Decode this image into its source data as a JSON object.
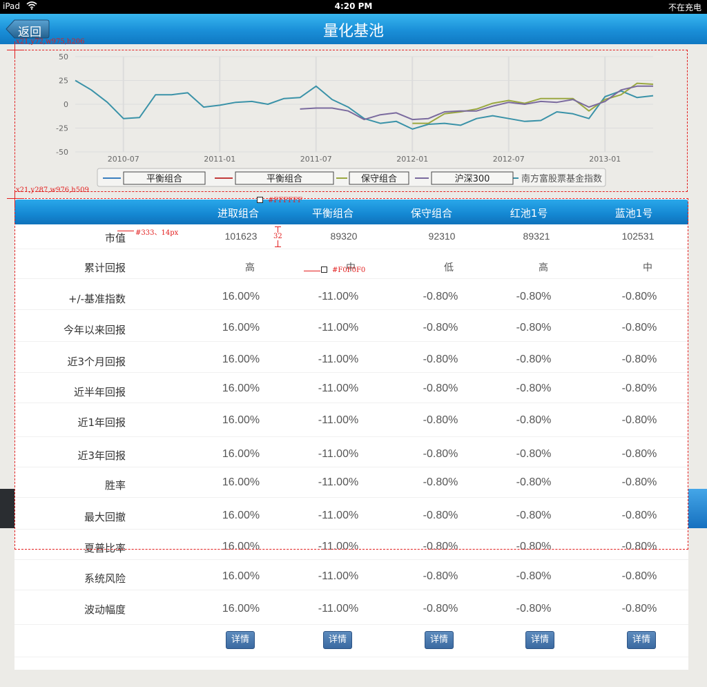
{
  "status_bar": {
    "device": "iPad",
    "time": "4:20 PM",
    "battery": "不在充电"
  },
  "nav": {
    "back_label": "返回",
    "title": "量化基池"
  },
  "chart_data": {
    "type": "line",
    "y_ticks": [
      "50",
      "25",
      "0",
      "-25",
      "-50"
    ],
    "ylim": [
      -50,
      50
    ],
    "x_ticks": [
      "2010-07",
      "2011-01",
      "2011-07",
      "2012-01",
      "2012-07",
      "2013-01"
    ],
    "x_domain": [
      "2010-04",
      "2013-04"
    ],
    "grid": true,
    "legend_position": "bottom",
    "legend_labels": [
      "平衡组合",
      "平衡组合",
      "保守组合",
      "沪深300",
      "南方富股票基金指数"
    ],
    "series": [
      {
        "name": "南方富股票基金指数",
        "color": "#3a92a8",
        "points": [
          [
            "2010-04",
            25
          ],
          [
            "2010-05",
            15
          ],
          [
            "2010-06",
            2
          ],
          [
            "2010-07",
            -15
          ],
          [
            "2010-08",
            -14
          ],
          [
            "2010-09",
            10
          ],
          [
            "2010-10",
            10
          ],
          [
            "2010-11",
            12
          ],
          [
            "2010-12",
            -3
          ],
          [
            "2011-01",
            -1
          ],
          [
            "2011-02",
            2
          ],
          [
            "2011-03",
            3
          ],
          [
            "2011-04",
            0
          ],
          [
            "2011-05",
            6
          ],
          [
            "2011-06",
            7
          ],
          [
            "2011-07",
            19
          ],
          [
            "2011-08",
            5
          ],
          [
            "2011-09",
            -3
          ],
          [
            "2011-10",
            -15
          ],
          [
            "2011-11",
            -20
          ],
          [
            "2011-12",
            -18
          ],
          [
            "2012-01",
            -26
          ],
          [
            "2012-02",
            -21
          ],
          [
            "2012-03",
            -20
          ],
          [
            "2012-04",
            -22
          ],
          [
            "2012-05",
            -15
          ],
          [
            "2012-06",
            -12
          ],
          [
            "2012-07",
            -15
          ],
          [
            "2012-08",
            -18
          ],
          [
            "2012-09",
            -17
          ],
          [
            "2012-10",
            -8
          ],
          [
            "2012-11",
            -10
          ],
          [
            "2012-12",
            -15
          ],
          [
            "2013-01",
            8
          ],
          [
            "2013-02",
            14
          ],
          [
            "2013-03",
            7
          ],
          [
            "2013-04",
            9
          ]
        ]
      },
      {
        "name": "平衡组合",
        "color": "#9aa840",
        "points": [
          [
            "2012-01",
            -20
          ],
          [
            "2012-02",
            -20
          ],
          [
            "2012-03",
            -10
          ],
          [
            "2012-04",
            -8
          ],
          [
            "2012-05",
            -5
          ],
          [
            "2012-06",
            1
          ],
          [
            "2012-07",
            4
          ],
          [
            "2012-08",
            1
          ],
          [
            "2012-09",
            6
          ],
          [
            "2012-10",
            6
          ],
          [
            "2012-11",
            6
          ],
          [
            "2012-12",
            -7
          ],
          [
            "2013-01",
            5
          ],
          [
            "2013-02",
            10
          ],
          [
            "2013-03",
            22
          ],
          [
            "2013-04",
            21
          ]
        ]
      },
      {
        "name": "沪深300",
        "color": "#7a6a9e",
        "points": [
          [
            "2011-06",
            -5
          ],
          [
            "2011-07",
            -4
          ],
          [
            "2011-08",
            -4
          ],
          [
            "2011-09",
            -7
          ],
          [
            "2011-10",
            -16
          ],
          [
            "2011-11",
            -11
          ],
          [
            "2011-12",
            -9
          ],
          [
            "2012-01",
            -16
          ],
          [
            "2012-02",
            -15
          ],
          [
            "2012-03",
            -8
          ],
          [
            "2012-04",
            -7
          ],
          [
            "2012-05",
            -7
          ],
          [
            "2012-06",
            -2
          ],
          [
            "2012-07",
            2
          ],
          [
            "2012-08",
            0
          ],
          [
            "2012-09",
            3
          ],
          [
            "2012-10",
            2
          ],
          [
            "2012-11",
            5
          ],
          [
            "2012-12",
            -3
          ],
          [
            "2013-01",
            3
          ],
          [
            "2013-02",
            15
          ],
          [
            "2013-03",
            19
          ],
          [
            "2013-04",
            19
          ]
        ]
      }
    ]
  },
  "table": {
    "columns": [
      "进取组合",
      "平衡组合",
      "保守组合",
      "红池1号",
      "蓝池1号"
    ],
    "rows": [
      {
        "label": "市值",
        "values": [
          "101623",
          "89320",
          "92310",
          "89321",
          "102531"
        ]
      },
      {
        "label": "累计回报",
        "values": [
          "高",
          "中",
          "低",
          "高",
          "中"
        ]
      },
      {
        "label": "+/-基准指数",
        "values": [
          "16.00%",
          "-11.00%",
          "-0.80%",
          "-0.80%",
          "-0.80%"
        ]
      },
      {
        "label": "今年以来回报",
        "values": [
          "16.00%",
          "-11.00%",
          "-0.80%",
          "-0.80%",
          "-0.80%"
        ]
      },
      {
        "label": "近3个月回报",
        "values": [
          "16.00%",
          "-11.00%",
          "-0.80%",
          "-0.80%",
          "-0.80%"
        ]
      },
      {
        "label": "近半年回报",
        "values": [
          "16.00%",
          "-11.00%",
          "-0.80%",
          "-0.80%",
          "-0.80%"
        ]
      },
      {
        "label": "近1年回报",
        "values": [
          "16.00%",
          "-11.00%",
          "-0.80%",
          "-0.80%",
          "-0.80%"
        ]
      },
      {
        "label": "近3年回报",
        "values": [
          "16.00%",
          "-11.00%",
          "-0.80%",
          "-0.80%",
          "-0.80%"
        ]
      },
      {
        "label": "胜率",
        "values": [
          "16.00%",
          "-11.00%",
          "-0.80%",
          "-0.80%",
          "-0.80%"
        ]
      },
      {
        "label": "最大回撤",
        "values": [
          "16.00%",
          "-11.00%",
          "-0.80%",
          "-0.80%",
          "-0.80%"
        ]
      },
      {
        "label": "夏普比率",
        "values": [
          "16.00%",
          "-11.00%",
          "-0.80%",
          "-0.80%",
          "-0.80%"
        ]
      },
      {
        "label": "系统风险",
        "values": [
          "16.00%",
          "-11.00%",
          "-0.80%",
          "-0.80%",
          "-0.80%"
        ]
      },
      {
        "label": "波动幅度",
        "values": [
          "16.00%",
          "-11.00%",
          "-0.80%",
          "-0.80%",
          "-0.80%"
        ]
      }
    ],
    "detail_label": "详情"
  },
  "annotations": {
    "chart_box": "x21,y72,w975,h206",
    "table_box": "x21,y287,w976,h509",
    "header_color": "#FFFFFF",
    "label_style": "#333、14px",
    "row_height": "32",
    "divider_color": "#F0F0F0"
  },
  "colors": {
    "accent": "#1a8fd8",
    "button": "#3b6aa1",
    "annotation": "#e21c1c",
    "divider": "#F0F0F0"
  }
}
